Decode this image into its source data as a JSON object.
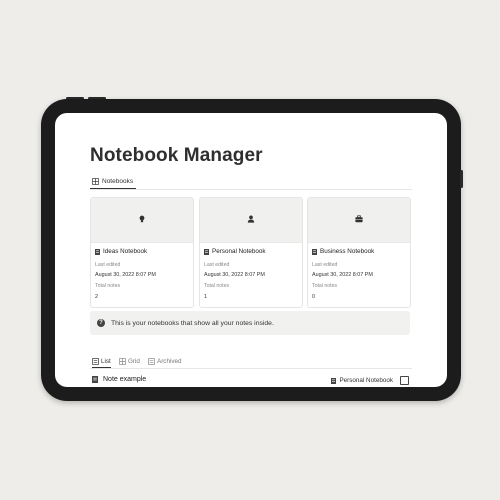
{
  "page": {
    "title": "Notebook Manager"
  },
  "tabs": [
    {
      "label": "Notebooks",
      "icon": "gallery-icon"
    }
  ],
  "cards": [
    {
      "name": "Ideas Notebook",
      "icon": "lightbulb-icon",
      "last_edited_label": "Last edited",
      "last_edited": "August 30, 2022 8:07 PM",
      "total_notes_label": "Total notes",
      "total_notes": "2"
    },
    {
      "name": "Personal Notebook",
      "icon": "person-icon",
      "last_edited_label": "Last edited",
      "last_edited": "August 30, 2022 8:07 PM",
      "total_notes_label": "Total notes",
      "total_notes": "1"
    },
    {
      "name": "Business Notebook",
      "icon": "briefcase-icon",
      "last_edited_label": "Last edited",
      "last_edited": "August 30, 2022 8:07 PM",
      "total_notes_label": "Total notes",
      "total_notes": "0"
    }
  ],
  "callout": {
    "icon": "question-icon",
    "glyph": "?",
    "text": "This is your notebooks that show all your notes inside."
  },
  "views": [
    {
      "label": "List",
      "icon": "list-icon"
    },
    {
      "label": "Grid",
      "icon": "grid-icon"
    },
    {
      "label": "Archived",
      "icon": "archive-icon"
    }
  ],
  "rows": [
    {
      "title": "Note example",
      "notebook": "Personal Notebook",
      "checked": false
    }
  ]
}
